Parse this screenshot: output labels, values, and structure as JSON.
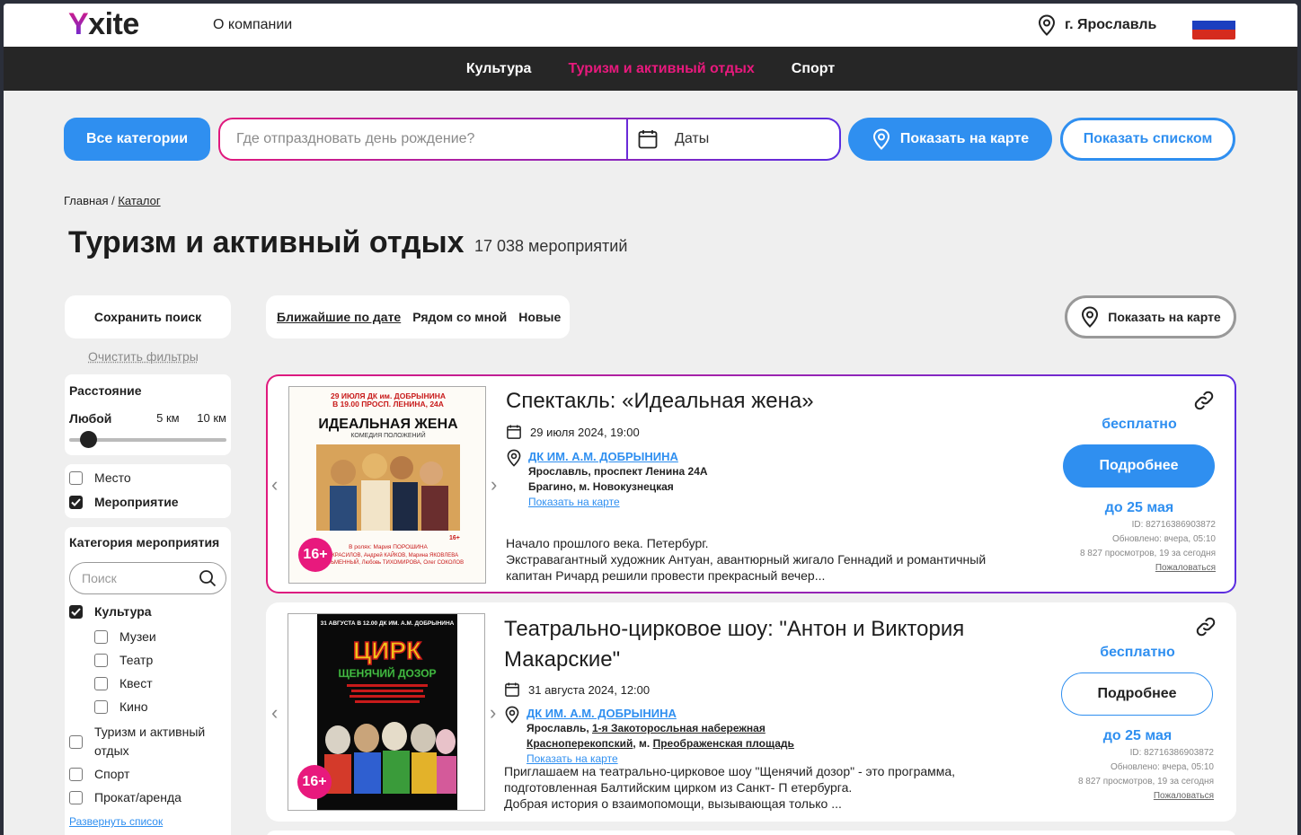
{
  "header": {
    "logo": "Yxite",
    "logo_first": "Y",
    "logo_rest": "xite",
    "about": "О компании",
    "city": "г. Ярославль"
  },
  "nav": {
    "items": [
      "Культура",
      "Туризм и активный отдых",
      "Спорт"
    ],
    "active": "Туризм и активный отдых"
  },
  "search": {
    "all_categories": "Все категории",
    "placeholder": "Где отпраздновать день рождение?",
    "dates": "Даты",
    "show_map": "Показать на карте",
    "show_list": "Показать списком"
  },
  "breadcrumb": {
    "home": "Главная",
    "sep": "/",
    "catalog": "Каталог"
  },
  "page": {
    "title": "Туризм и активный отдых",
    "count": "17 038 мероприятий"
  },
  "filters": {
    "save": "Сохранить поиск",
    "clear": "Очистить фильтры",
    "distance": {
      "title": "Расстояние",
      "options": [
        "Любой",
        "5 км",
        "10 км"
      ],
      "selected": "Любой"
    },
    "type": [
      {
        "label": "Место",
        "checked": false
      },
      {
        "label": "Мероприятие",
        "checked": true
      }
    ],
    "category": {
      "title": "Категория мероприятия",
      "search_placeholder": "Поиск",
      "items": [
        {
          "label": "Культура",
          "checked": true,
          "children": [
            {
              "label": "Музеи",
              "checked": false
            },
            {
              "label": "Театр",
              "checked": false
            },
            {
              "label": "Квест",
              "checked": false
            },
            {
              "label": "Кино",
              "checked": false
            }
          ]
        },
        {
          "label": "Туризм и активный отдых",
          "checked": false
        },
        {
          "label": "Спорт",
          "checked": false
        },
        {
          "label": "Прокат/аренда",
          "checked": false
        }
      ],
      "expand": "Развернуть список"
    }
  },
  "sort": {
    "options": [
      "Ближайшие по дате",
      "Рядом со мной",
      "Новые"
    ],
    "active": "Ближайшие по дате",
    "show_map": "Показать на карте"
  },
  "cards": [
    {
      "title": "Спектакль: «Идеальная жена»",
      "date": "29 июля 2024, 19:00",
      "place": "ДК ИМ. А.М. ДОБРЫНИНА",
      "address": "Ярославль, проспект Ленина 24А",
      "metro": "Брагино, м. Новокузнецкая",
      "show_map": "Показать на карте",
      "desc": [
        "Начало прошлого века. Петербург.",
        "Экстравагантный художник Антуан, авантюрный жигало Геннадий и романтичный",
        "капитан Ричард решили провести прекрасный вечер..."
      ],
      "price": "бесплатно",
      "more": "Подробнее",
      "until": "до 25 мая",
      "id": "ID: 82716386903872",
      "updated": "Обновлено: вчера, 05:10",
      "views": "8 827 просмотров, 19 за сегодня",
      "report": "Пожаловаться",
      "age": "16+",
      "poster": {
        "top": "29 ИЮЛЯ    ДК им. ДОБРЫНИНА",
        "top2": "В 19.00    ПРОСП. ЛЕНИНА, 24А",
        "name": "ИДЕАЛЬНАЯ ЖЕНА",
        "sub": "КОМЕДИЯ ПОЛОЖЕНИЙ",
        "cast1": "В ролях: Мария ПОРОШИНА",
        "cast2": "Пётр КРАСИЛОВ, Андрей КАЙКОВ, Марина ЯКОВЛЕВА",
        "cast3": "А. ПИСЬМЕННЫЙ, Любовь ТИХОМИРОВА, Олег СОКОЛОВ",
        "age": "16+"
      }
    },
    {
      "title": "Театрально-цирковое шоу: \"Антон и Виктория Макарские\"",
      "date": "31 августа 2024, 12:00",
      "place": "ДК ИМ. А.М. ДОБРЫНИНА",
      "address_prefix": "Ярославль, ",
      "address_link": "1-я Закоторосльная набережная",
      "metro_link1": "Красноперекопский",
      "metro_mid": ", м. ",
      "metro_link2": "Преображенская площадь",
      "show_map": "Показать на карте",
      "desc": [
        "Приглашаем на театрально-цирковое шоу \"Щенячий дозор\" - это программа,",
        "подготовленная Балтийским цирком из Санкт- П етербурга.",
        "Добрая история о взаимопомощи, вызывающая только ..."
      ],
      "price": "бесплатно",
      "more": "Подробнее",
      "until": "до 25 мая",
      "id": "ID: 82716386903872",
      "updated": "Обновлено: вчера, 05:10",
      "views": "8 827 просмотров, 19 за сегодня",
      "report": "Пожаловаться",
      "age": "16+",
      "poster": {
        "top": "31 АВГУСТА В 12.00    ДК ИМ. А.М. ДОБРЫНИНА",
        "name": "ЦИРК",
        "sub": "ЩЕНЯЧИЙ ДОЗОР"
      }
    }
  ],
  "colors": {
    "accent": "#2f8ff0",
    "pink": "#e8197d",
    "purple": "#5b2de0",
    "nav_bg": "#262626",
    "page_bg": "#efefef"
  }
}
